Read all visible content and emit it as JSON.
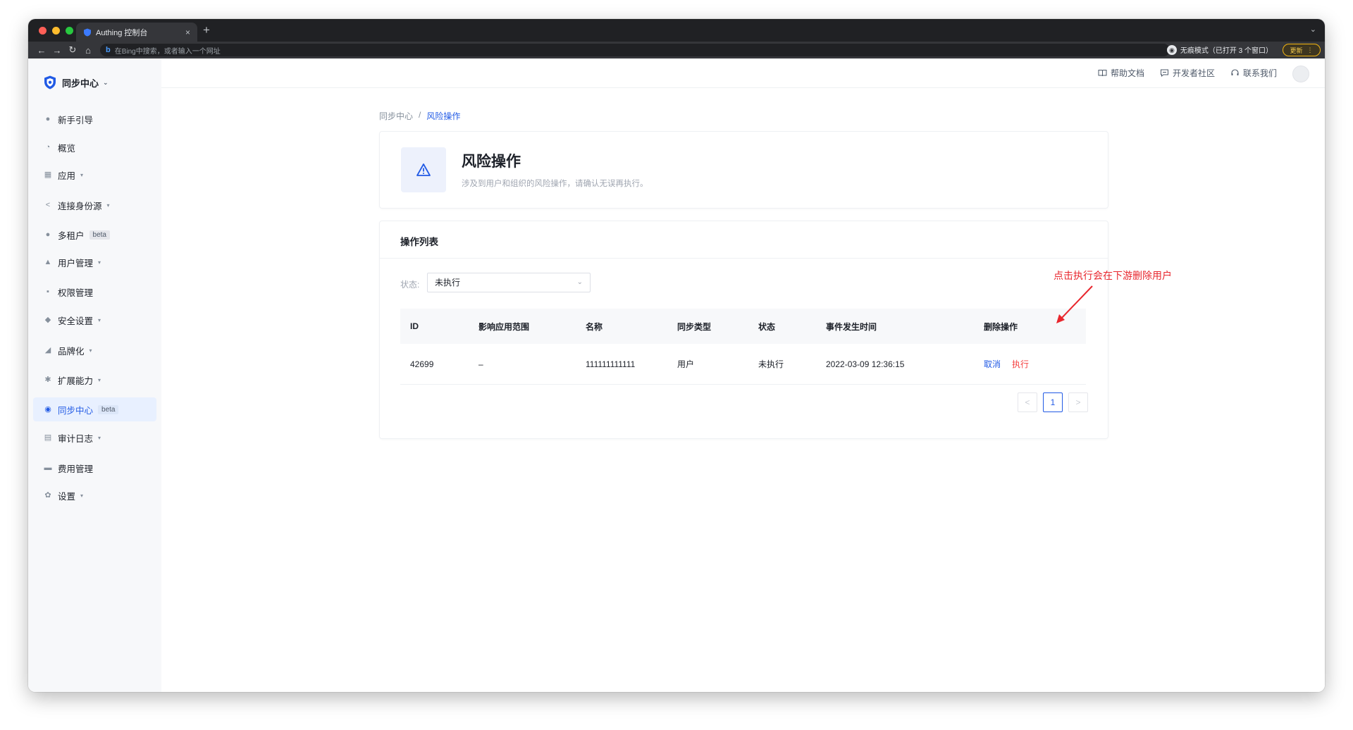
{
  "browser": {
    "tab_title": "Authing 控制台",
    "tab_close": "×",
    "new_tab": "+",
    "tab_dropdown": "⌄",
    "nav_back": "←",
    "nav_forward": "→",
    "nav_reload": "↻",
    "nav_home": "⌂",
    "omnibox_icon": "b",
    "omnibox_placeholder": "在Bing中搜索，或者输入一个网址",
    "incognito_label": "无痕模式（已打开 3 个窗口）",
    "update_label": "更新",
    "update_menu": "⋮"
  },
  "sidebar": {
    "brand": "同步中心",
    "brand_caret": "⌄",
    "items": [
      {
        "label": "新手引导",
        "icon": "guide-icon",
        "glyph": "●",
        "chevron": false,
        "beta": false,
        "active": false
      },
      {
        "label": "概览",
        "icon": "pie-icon",
        "glyph": "◔",
        "chevron": false,
        "beta": false,
        "active": false
      },
      {
        "label": "应用",
        "icon": "apps-icon",
        "glyph": "▦",
        "chevron": true,
        "beta": false,
        "active": false
      },
      {
        "label": "连接身份源",
        "icon": "share-icon",
        "glyph": "<",
        "chevron": true,
        "beta": false,
        "active": false
      },
      {
        "label": "多租户",
        "icon": "tenant-icon",
        "glyph": "●",
        "chevron": false,
        "beta": true,
        "active": false
      },
      {
        "label": "用户管理",
        "icon": "users-icon",
        "glyph": "▲",
        "chevron": true,
        "beta": false,
        "active": false
      },
      {
        "label": "权限管理",
        "icon": "lock-icon",
        "glyph": "▪",
        "chevron": false,
        "beta": false,
        "active": false
      },
      {
        "label": "安全设置",
        "icon": "shield-icon",
        "glyph": "◆",
        "chevron": true,
        "beta": false,
        "active": false
      },
      {
        "label": "品牌化",
        "icon": "brand-icon",
        "glyph": "◢",
        "chevron": true,
        "beta": false,
        "active": false
      },
      {
        "label": "扩展能力",
        "icon": "extension-icon",
        "glyph": "✱",
        "chevron": true,
        "beta": false,
        "active": false
      },
      {
        "label": "同步中心",
        "icon": "sync-icon",
        "glyph": "◉",
        "chevron": false,
        "beta": true,
        "active": true
      },
      {
        "label": "审计日志",
        "icon": "audit-icon",
        "glyph": "▤",
        "chevron": true,
        "beta": false,
        "active": false
      },
      {
        "label": "费用管理",
        "icon": "billing-icon",
        "glyph": "▬",
        "chevron": false,
        "beta": false,
        "active": false
      },
      {
        "label": "设置",
        "icon": "settings-icon",
        "glyph": "✿",
        "chevron": true,
        "beta": false,
        "active": false
      }
    ],
    "beta_label": "beta",
    "chevron_glyph": "▾"
  },
  "topbar": {
    "help_docs": "帮助文档",
    "dev_community": "开发者社区",
    "contact_us": "联系我们"
  },
  "breadcrumb": {
    "parent": "同步中心",
    "separator": "/",
    "current": "风险操作"
  },
  "header": {
    "title": "风险操作",
    "description": "涉及到用户和组织的风险操作，请确认无误再执行。"
  },
  "list": {
    "title": "操作列表",
    "filter_label": "状态:",
    "filter_value": "未执行",
    "filter_chevron": "⌄",
    "columns": [
      "ID",
      "影响应用范围",
      "名称",
      "同步类型",
      "状态",
      "事件发生时间",
      "删除操作"
    ],
    "rows": [
      {
        "id": "42699",
        "scope": "–",
        "name": "111111111111",
        "sync_type": "用户",
        "status": "未执行",
        "time": "2022-03-09 12:36:15",
        "cancel": "取消",
        "execute": "执行"
      }
    ],
    "pagination": {
      "prev": "<",
      "current": "1",
      "next": ">"
    }
  },
  "annotation": {
    "text": "点击执行会在下游删除用户",
    "color": "#e8262d"
  },
  "colors": {
    "primary": "#215ae5",
    "danger": "#f53f3f",
    "sidebar_bg": "#f7f8fa",
    "active_bg": "#e8f0ff"
  }
}
